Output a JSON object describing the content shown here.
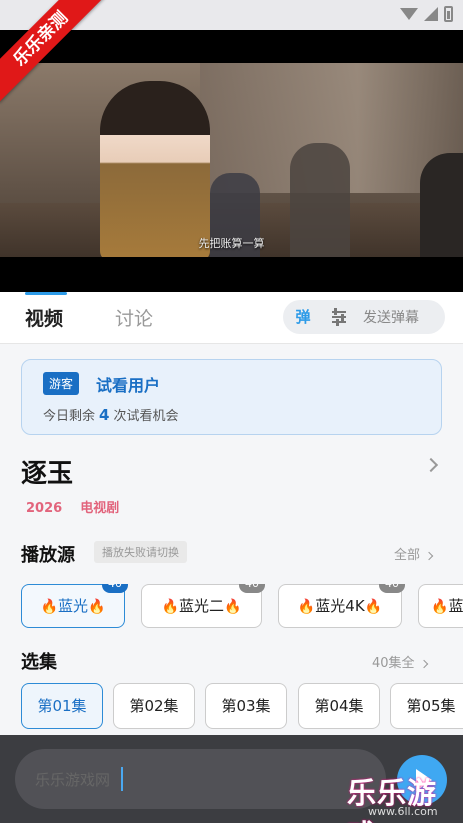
{
  "watermark": {
    "ribbon": "乐乐亲测",
    "brand": "乐乐游戏",
    "url": "www.6ll.com"
  },
  "player": {
    "subtitle": "先把账算一算"
  },
  "tabs": [
    {
      "label": "视频"
    },
    {
      "label": "讨论"
    }
  ],
  "danmaku": {
    "toggle": "弹",
    "send_label": "发送弹幕"
  },
  "guest": {
    "badge": "游客",
    "title": "试看用户",
    "prefix": "今日剩余",
    "count": "4",
    "suffix": "次试看机会"
  },
  "show": {
    "title": "逐玉",
    "year": "2026",
    "category": "电视剧"
  },
  "sources": {
    "title": "播放源",
    "hint": "播放失败请切换",
    "more": "全部",
    "items": [
      {
        "label": "蓝光",
        "badge": "40"
      },
      {
        "label": "蓝光二",
        "badge": "40"
      },
      {
        "label": "蓝光4K",
        "badge": "40"
      },
      {
        "label": "蓝"
      }
    ]
  },
  "episodes": {
    "title": "选集",
    "total": "40集全",
    "items": [
      {
        "label": "第01集"
      },
      {
        "label": "第02集"
      },
      {
        "label": "第03集"
      },
      {
        "label": "第04集"
      },
      {
        "label": "第05集"
      }
    ]
  },
  "comment": {
    "value": "乐乐游戏网"
  }
}
